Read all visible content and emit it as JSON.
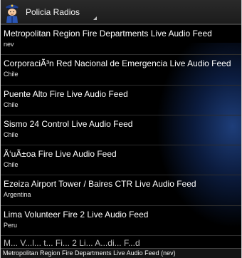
{
  "header": {
    "app_title": "Policia Radios",
    "app_icon": "police-officer-icon"
  },
  "feeds": [
    {
      "title": "Metropolitan Region Fire Departments Live Audio Feed",
      "subtitle": "nev"
    },
    {
      "title": "CorporaciÃ³n Red Nacional de Emergencia Live Audio Feed",
      "subtitle": "Chile"
    },
    {
      "title": "Puente Alto Fire Live Audio Feed",
      "subtitle": "Chile"
    },
    {
      "title": "Sismo 24 Control Live Audio Feed",
      "subtitle": "Chile"
    },
    {
      "title": "Ã‘uÃ±oa Fire Live Audio Feed",
      "subtitle": "Chile"
    },
    {
      "title": "Ezeiza Airport Tower / Baires CTR Live Audio Feed",
      "subtitle": "Argentina"
    },
    {
      "title": "Lima Volunteer Fire 2 Live Audio Feed",
      "subtitle": "Peru"
    },
    {
      "title": "M... V...l... t... Fi... 2 Li... A...di... F...d",
      "subtitle": ""
    }
  ],
  "status": {
    "now_playing": "Metropolitan Region Fire Departments Live Audio Feed (nev)"
  },
  "colors": {
    "background": "#000000",
    "glow": "#1e3e7a"
  }
}
